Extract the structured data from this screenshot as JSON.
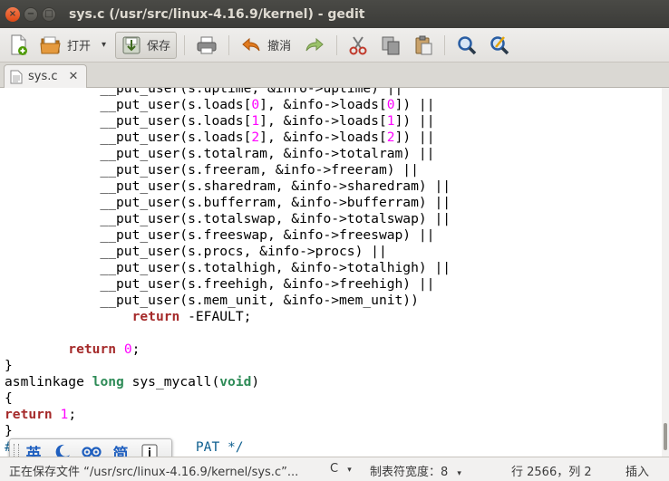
{
  "window": {
    "title": "sys.c (/usr/src/linux-4.16.9/kernel) - gedit",
    "close_glyph": "×",
    "minimize_glyph": "−",
    "maximize_glyph": "□"
  },
  "toolbar": {
    "new_icon": "new-document-icon",
    "open_label": "打开",
    "open_dropdown_glyph": "▾",
    "save_label": "保存",
    "print_icon": "print-icon",
    "undo_label": "撤消",
    "redo_icon": "redo-icon",
    "cut_icon": "cut-icon",
    "copy_icon": "copy-icon",
    "paste_icon": "paste-icon",
    "find_icon": "find-icon",
    "replace_icon": "find-replace-icon"
  },
  "tabs": [
    {
      "label": "sys.c",
      "close_glyph": "✕"
    }
  ],
  "editor": {
    "lines": [
      [
        {
          "t": "            __put_user(s.uptime, &info->uptime) ||"
        }
      ],
      [
        {
          "t": "            __put_user(s.loads["
        },
        {
          "t": "0",
          "c": "num"
        },
        {
          "t": "], &info->loads["
        },
        {
          "t": "0",
          "c": "num"
        },
        {
          "t": "]) ||"
        }
      ],
      [
        {
          "t": "            __put_user(s.loads["
        },
        {
          "t": "1",
          "c": "num"
        },
        {
          "t": "], &info->loads["
        },
        {
          "t": "1",
          "c": "num"
        },
        {
          "t": "]) ||"
        }
      ],
      [
        {
          "t": "            __put_user(s.loads["
        },
        {
          "t": "2",
          "c": "num"
        },
        {
          "t": "], &info->loads["
        },
        {
          "t": "2",
          "c": "num"
        },
        {
          "t": "]) ||"
        }
      ],
      [
        {
          "t": "            __put_user(s.totalram, &info->totalram) ||"
        }
      ],
      [
        {
          "t": "            __put_user(s.freeram, &info->freeram) ||"
        }
      ],
      [
        {
          "t": "            __put_user(s.sharedram, &info->sharedram) ||"
        }
      ],
      [
        {
          "t": "            __put_user(s.bufferram, &info->bufferram) ||"
        }
      ],
      [
        {
          "t": "            __put_user(s.totalswap, &info->totalswap) ||"
        }
      ],
      [
        {
          "t": "            __put_user(s.freeswap, &info->freeswap) ||"
        }
      ],
      [
        {
          "t": "            __put_user(s.procs, &info->procs) ||"
        }
      ],
      [
        {
          "t": "            __put_user(s.totalhigh, &info->totalhigh) ||"
        }
      ],
      [
        {
          "t": "            __put_user(s.freehigh, &info->freehigh) ||"
        }
      ],
      [
        {
          "t": "            __put_user(s.mem_unit, &info->mem_unit))"
        }
      ],
      [
        {
          "t": "                "
        },
        {
          "t": "return",
          "c": "kw"
        },
        {
          "t": " -EFAULT;"
        }
      ],
      [
        {
          "t": ""
        }
      ],
      [
        {
          "t": "        "
        },
        {
          "t": "return",
          "c": "kw"
        },
        {
          "t": " "
        },
        {
          "t": "0",
          "c": "num"
        },
        {
          "t": ";"
        }
      ],
      [
        {
          "t": "}"
        }
      ],
      [
        {
          "t": "asmlinkage "
        },
        {
          "t": "long",
          "c": "ty"
        },
        {
          "t": " sys_mycall("
        },
        {
          "t": "void",
          "c": "ty"
        },
        {
          "t": ")"
        }
      ],
      [
        {
          "t": "{"
        }
      ],
      [
        {
          "t": "return",
          "c": "kw"
        },
        {
          "t": " "
        },
        {
          "t": "1",
          "c": "num"
        },
        {
          "t": ";"
        }
      ],
      [
        {
          "t": "}"
        }
      ],
      [
        {
          "t": "#",
          "c": "pp"
        },
        {
          "t": "                       PAT */",
          "c": "pp"
        }
      ]
    ]
  },
  "ime_toolbar": {
    "mode_char": "英",
    "moon_icon": "half-width-moon-icon",
    "punct_icon": "punctuation-icon",
    "simplified_char": "简",
    "info_icon": "info-icon"
  },
  "statusbar": {
    "message": "正在保存文件 “/usr/src/linux-4.16.9/kernel/sys.c”...",
    "language": "C",
    "language_dropdown_glyph": "▾",
    "tab_width": "制表符宽度：8",
    "tab_width_dropdown_glyph": "▾",
    "position": "行 2566，列 2",
    "mode": "插入"
  },
  "colors": {
    "keyword": "#a52a2a",
    "type": "#2e8b57",
    "number": "#ff00ff",
    "titlebar": "#3c3b37",
    "close_button": "#dd4814"
  }
}
